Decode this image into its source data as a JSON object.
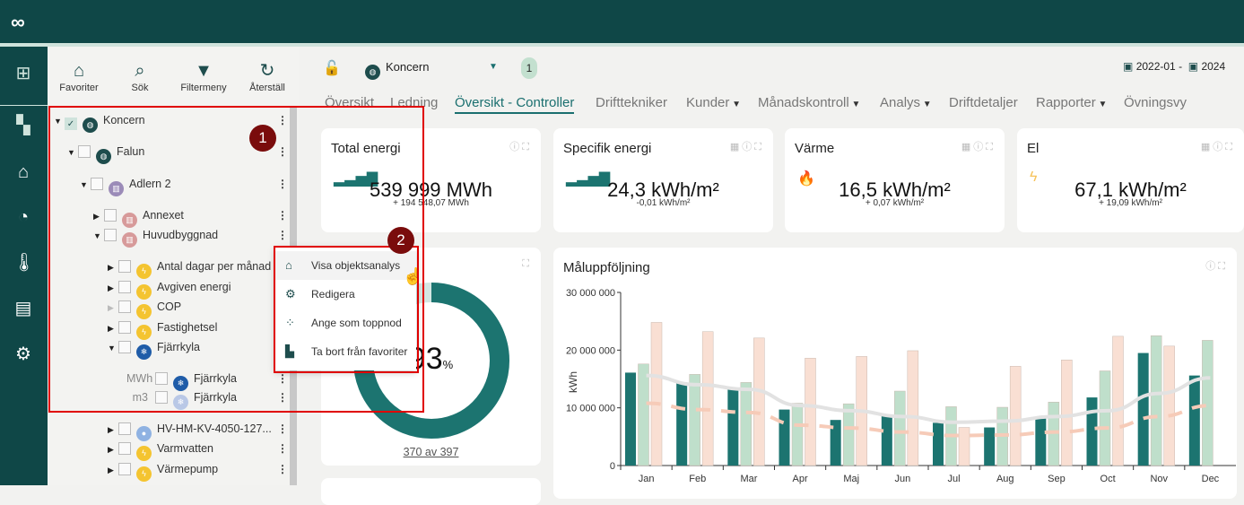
{
  "app": {
    "logo": "infinity-logo"
  },
  "rail": [
    "tree-icon",
    "dashboard-icon",
    "building-icon",
    "gauge-icon",
    "thermometer-icon",
    "report-icon",
    "building-settings-icon"
  ],
  "toolbar": [
    {
      "label": "Favoriter",
      "icon": "favorite-home-icon"
    },
    {
      "label": "Sök",
      "icon": "search-icon"
    },
    {
      "label": "Filtermeny",
      "icon": "filter-icon"
    },
    {
      "label": "Återställ",
      "icon": "reset-icon"
    }
  ],
  "tree": [
    {
      "label": "Koncern",
      "checked": true,
      "expanded": true,
      "icon": "globe",
      "color": "#1e4d4d"
    },
    {
      "label": "Falun",
      "expanded": true,
      "icon": "globe",
      "color": "#1e4d4d"
    },
    {
      "label": "Adlern 2",
      "expanded": true,
      "icon": "building",
      "color": "#9b8bb8"
    },
    {
      "label": "Annexet",
      "expanded": false,
      "icon": "building",
      "color": "#d79a9a"
    },
    {
      "label": "Huvudbyggnad",
      "expanded": true,
      "icon": "building",
      "color": "#d79a9a"
    },
    {
      "label": "Antal dagar per månad",
      "expanded": false,
      "icon": "energy",
      "color": "#f4c430"
    },
    {
      "label": "Avgiven energi",
      "expanded": false,
      "icon": "energy",
      "color": "#f4c430"
    },
    {
      "label": "COP",
      "expanded": false,
      "icon": "energy",
      "color": "#f4c430"
    },
    {
      "label": "Fastighetsel",
      "expanded": false,
      "icon": "energy",
      "color": "#f4c430"
    },
    {
      "label": "Fjärrkyla",
      "expanded": true,
      "icon": "snow",
      "color": "#1f5ca8"
    },
    {
      "label": "Fjärrkyla",
      "unit": "MWh",
      "icon": "snow",
      "color": "#1f5ca8"
    },
    {
      "label": "Fjärrkyla",
      "unit": "m3",
      "icon": "snow",
      "color": "#b9c8e6"
    },
    {
      "label": "HV-HM-KV-4050-127...",
      "expanded": false,
      "icon": "water",
      "color": "#8fb2e2"
    },
    {
      "label": "Varmvatten",
      "expanded": false,
      "icon": "energy",
      "color": "#f4c430"
    },
    {
      "label": "Värmepump",
      "expanded": false,
      "icon": "energy",
      "color": "#f4c430"
    }
  ],
  "header": {
    "node": "Koncern",
    "count": "1",
    "date_from": "2022-01",
    "date_sep": "-",
    "date_to": "2024"
  },
  "tabs": [
    "Översikt",
    "Ledning",
    "Översikt - Controller",
    "Drifttekniker",
    "Kunder",
    "Månadskontroll",
    "Analys",
    "Driftdetaljer",
    "Rapporter",
    "Övningsvy"
  ],
  "active_tab": 2,
  "kpis": [
    {
      "title": "Total energi",
      "value": "539 999 MWh",
      "delta": "+ 194 548,07 MWh",
      "icon": "signal-icon"
    },
    {
      "title": "Specifik energi",
      "value": "24,3 kWh/m²",
      "delta": "-0,01 kWh/m²",
      "icon": "signal-icon"
    },
    {
      "title": "Värme",
      "value": "16,5 kWh/m²",
      "delta": "+ 0,07 kWh/m²",
      "icon": "flame-icon"
    },
    {
      "title": "El",
      "value": "67,1 kWh/m²",
      "delta": "+ 19,09 kWh/m²",
      "icon": "bolt-icon"
    }
  ],
  "donut": {
    "value": "93",
    "unit": "%",
    "caption": "370 av 397",
    "fraction": 0.932
  },
  "menu": [
    {
      "label": "Visa objektsanalys",
      "icon": "home-icon"
    },
    {
      "label": "Redigera",
      "icon": "gear-icon"
    },
    {
      "label": "Ange som toppnod",
      "icon": "grid-icon"
    },
    {
      "label": "Ta bort från favoriter",
      "icon": "remove-favorite-icon"
    }
  ],
  "annotations": [
    "1",
    "2"
  ],
  "chart_data": {
    "type": "bar",
    "title": "Måluppföljning",
    "ylabel": "kWh",
    "ylim": [
      0,
      30000000
    ],
    "yticks": [
      "0",
      "10 000 000",
      "20 000 000",
      "30 000 000"
    ],
    "categories": [
      "Jan",
      "Feb",
      "Mar",
      "Apr",
      "Maj",
      "Jun",
      "Jul",
      "Aug",
      "Sep",
      "Oct",
      "Nov",
      "Dec"
    ],
    "series": [
      {
        "type": "bar",
        "color": "#1c7470",
        "values": [
          16100000,
          14400000,
          13400000,
          9700000,
          7900000,
          8600000,
          7400000,
          6600000,
          8300000,
          11800000,
          19500000,
          15600000
        ]
      },
      {
        "type": "bar",
        "color": "#bfdfcb",
        "values": [
          17600000,
          15800000,
          14400000,
          10800000,
          10700000,
          12900000,
          10200000,
          10100000,
          11000000,
          16400000,
          22500000,
          21700000
        ]
      },
      {
        "type": "bar",
        "color": "#f9dfd3",
        "values": [
          24800000,
          23200000,
          22100000,
          18600000,
          18900000,
          19900000,
          6600000,
          17200000,
          18300000,
          22400000,
          20700000,
          null
        ]
      },
      {
        "type": "line",
        "color": "#e2e2e2",
        "values": [
          15600000,
          14000000,
          13200000,
          10400000,
          9500000,
          8500000,
          7500000,
          7700000,
          8500000,
          9500000,
          12500000,
          15200000
        ]
      },
      {
        "type": "line",
        "dashed": true,
        "color": "#f6cbb8",
        "values": [
          10800000,
          9700000,
          9200000,
          7000000,
          6500000,
          5800000,
          5200000,
          5300000,
          5800000,
          6500000,
          8500000,
          10400000
        ]
      }
    ]
  }
}
